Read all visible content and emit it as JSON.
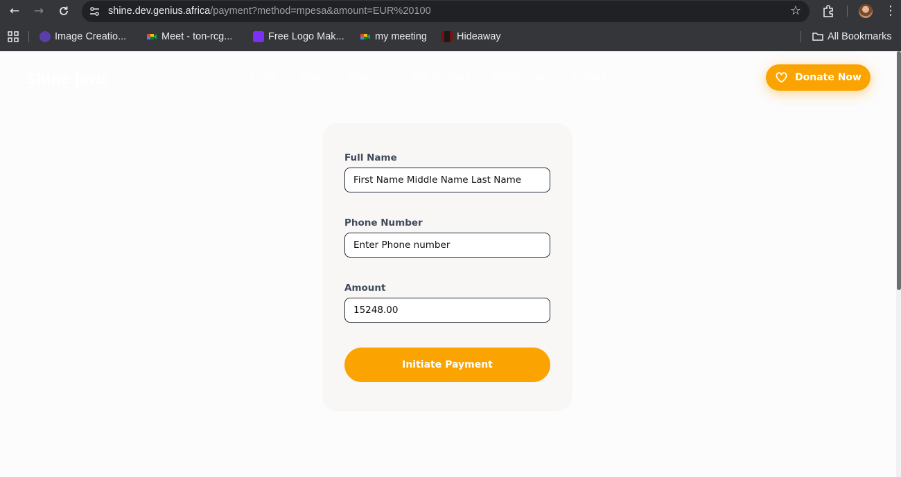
{
  "browser": {
    "url_host": "shine.dev.genius.africa",
    "url_path": "/payment?method=mpesa&amount=EUR%20100",
    "bookmarks": [
      {
        "label": "Image Creatio...",
        "color": "#5b3fa8"
      },
      {
        "label": "Meet - ton-rcg...",
        "color": "#00832d"
      },
      {
        "label": "Free Logo Mak...",
        "color": "#7b2ff7"
      },
      {
        "label": "my meeting",
        "color": "#00832d"
      },
      {
        "label": "Hideaway",
        "color": "#7a0f0f"
      }
    ],
    "all_bookmarks_label": "All Bookmarks"
  },
  "header": {
    "logo": "Shine Jeru",
    "nav": [
      "Home",
      "About",
      "Programs",
      "Get Involved",
      "Partnerships",
      "Contact"
    ],
    "donate_label": "Donate Now"
  },
  "form": {
    "full_name_label": "Full Name",
    "full_name_placeholder": "First Name Middle Name Last Name",
    "phone_label": "Phone Number",
    "phone_placeholder": "Enter Phone number",
    "amount_label": "Amount",
    "amount_value": "15248.00",
    "submit_label": "Initiate Payment"
  },
  "colors": {
    "accent": "#fba300",
    "chrome_dark": "#35363a",
    "omnibox": "#202124"
  }
}
